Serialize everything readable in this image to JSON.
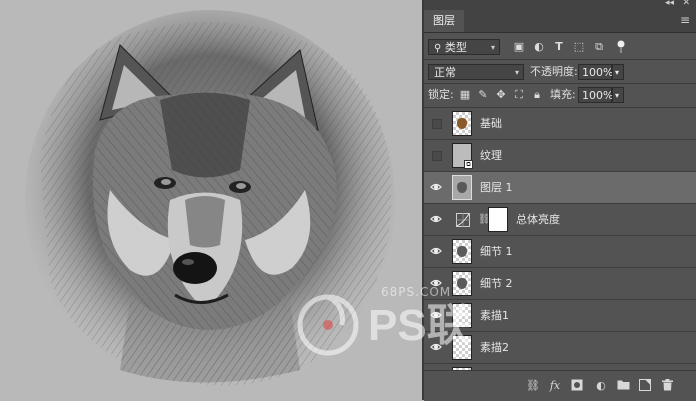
{
  "panel": {
    "tab_label": "图层",
    "filter_kind": "类型",
    "blend_mode": "正常",
    "opacity_label": "不透明度:",
    "opacity_value": "100%",
    "lock_label": "锁定:",
    "fill_label": "填充:",
    "fill_value": "100%"
  },
  "layers": [
    {
      "name": "基础",
      "visible": false,
      "type": "image",
      "selected": false
    },
    {
      "name": "纹理",
      "visible": false,
      "type": "smart",
      "selected": false
    },
    {
      "name": "图层 1",
      "visible": true,
      "type": "image",
      "selected": true
    },
    {
      "name": "总体亮度",
      "visible": true,
      "type": "adjustment",
      "selected": false
    },
    {
      "name": "细节 1",
      "visible": true,
      "type": "image",
      "selected": false
    },
    {
      "name": "细节 2",
      "visible": true,
      "type": "image",
      "selected": false
    },
    {
      "name": "素描1",
      "visible": true,
      "type": "transparent",
      "selected": false
    },
    {
      "name": "素描2",
      "visible": true,
      "type": "transparent",
      "selected": false
    }
  ],
  "watermark": {
    "url": "68PS.COM"
  },
  "colors": {
    "panel_bg": "#535353",
    "selected_row": "#6b6b6b",
    "canvas_bg": "#b9b9b9"
  }
}
